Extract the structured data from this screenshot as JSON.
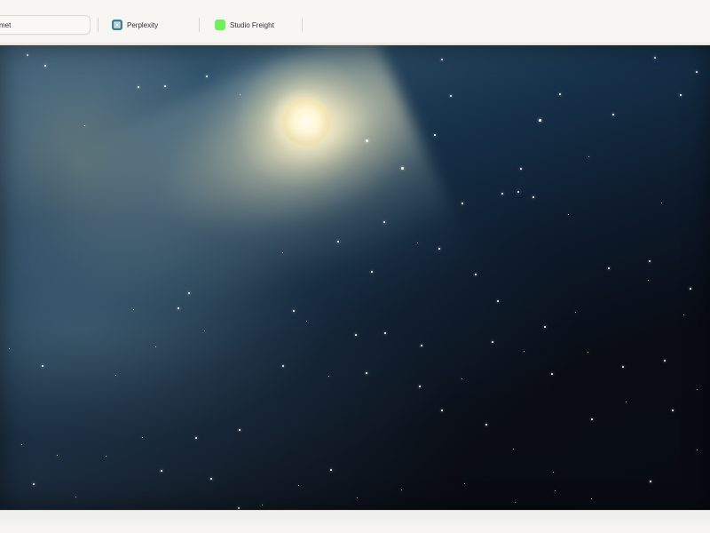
{
  "tabs": [
    {
      "label": "met",
      "active": true,
      "icon": ""
    },
    {
      "label": "Perplexity",
      "active": false,
      "icon": "perplexity-icon",
      "icon_color": "#3f7f95"
    },
    {
      "label": "Studio Freight",
      "active": false,
      "icon": "studio-freight-icon",
      "icon_color": "#6df05a"
    }
  ],
  "content": {
    "scene": "comet-over-starry-night-sky"
  },
  "colors": {
    "background": "#f6f5f1",
    "sky_dark": "#090d16",
    "comet_glow": "#fff1c7",
    "perplexity": "#3f7f95",
    "studio_freight": "#6df05a"
  }
}
